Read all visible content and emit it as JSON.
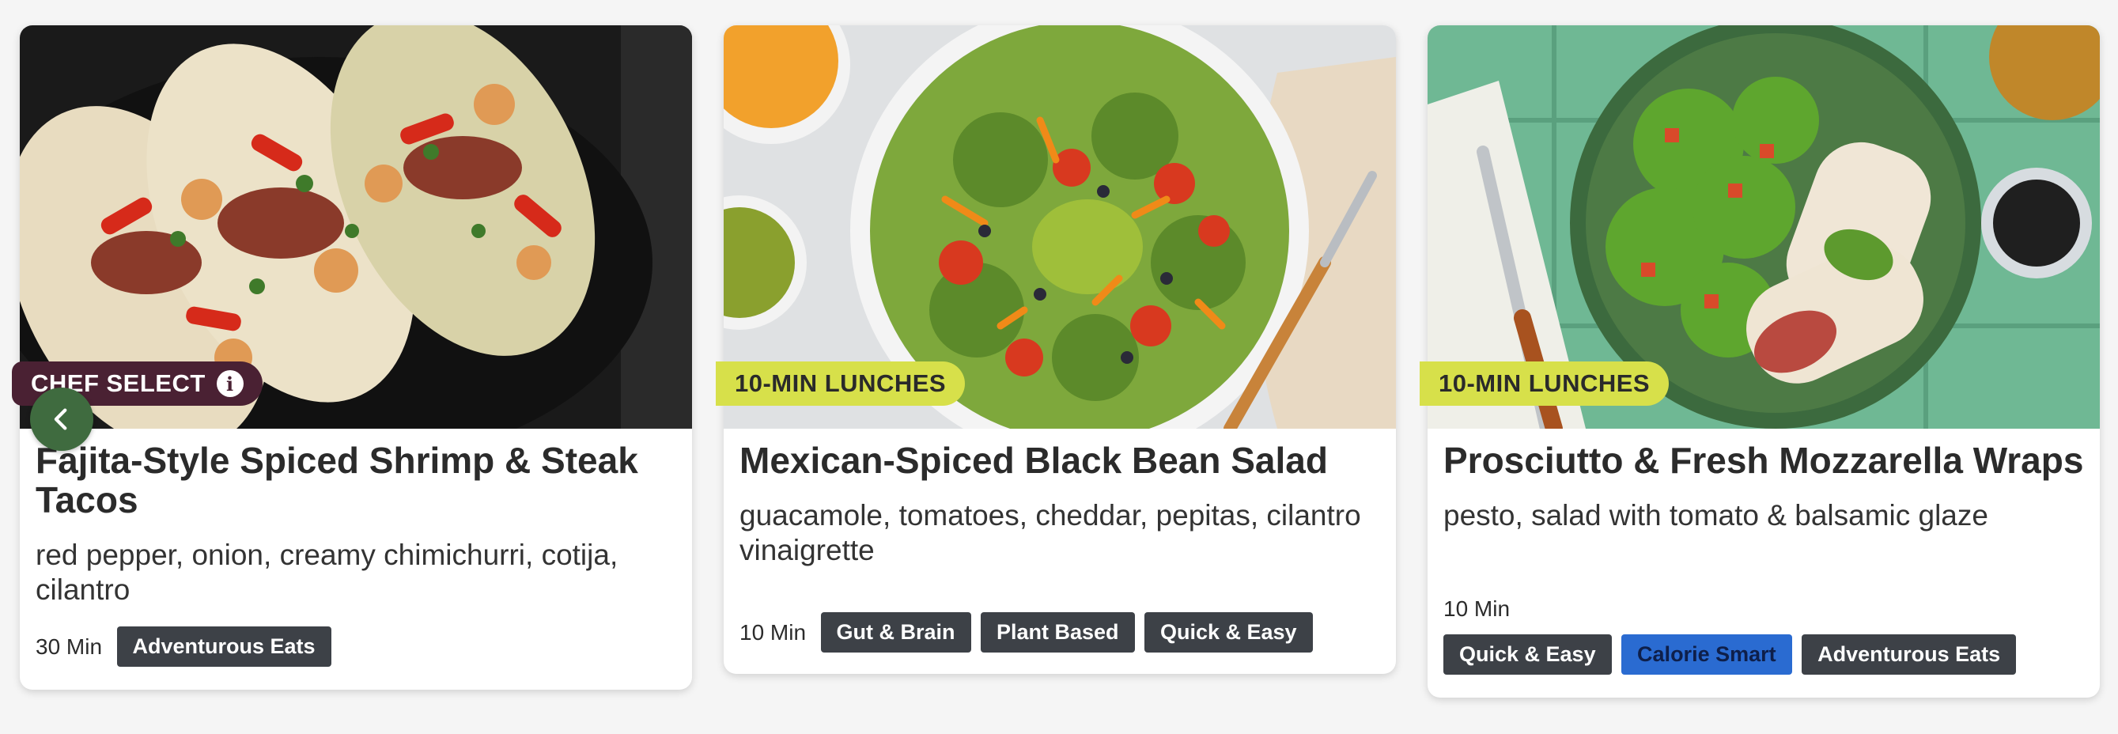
{
  "cards": [
    {
      "badge": "CHEF SELECT",
      "title": "Fajita-Style Spiced Shrimp & Steak Tacos",
      "description": "red pepper, onion, creamy chimichurri, cotija, cilantro",
      "time": "30 Min",
      "tags": [
        "Adventurous Eats"
      ]
    },
    {
      "badge": "10-MIN LUNCHES",
      "title": "Mexican-Spiced Black Bean Salad",
      "description": "guacamole, tomatoes, cheddar, pepitas, cilantro vinaigrette",
      "time": "10 Min",
      "tags": [
        "Gut & Brain",
        "Plant Based",
        "Quick & Easy"
      ]
    },
    {
      "badge": "10-MIN LUNCHES",
      "title": "Prosciutto & Fresh Mozzarella Wraps",
      "description": "pesto, salad with tomato & balsamic glaze",
      "time": "10 Min",
      "tags": [
        "Quick & Easy",
        "Calorie Smart",
        "Adventurous Eats"
      ]
    }
  ],
  "icons": {
    "info": "info-icon",
    "prev": "chevron-left-icon"
  },
  "colors": {
    "lunch_badge": "#d7e04a",
    "chef_badge": "#4a2133",
    "tag_dark": "#3d4147",
    "tag_blue": "#2a6bd1",
    "prev_button": "#3f6b3f"
  }
}
